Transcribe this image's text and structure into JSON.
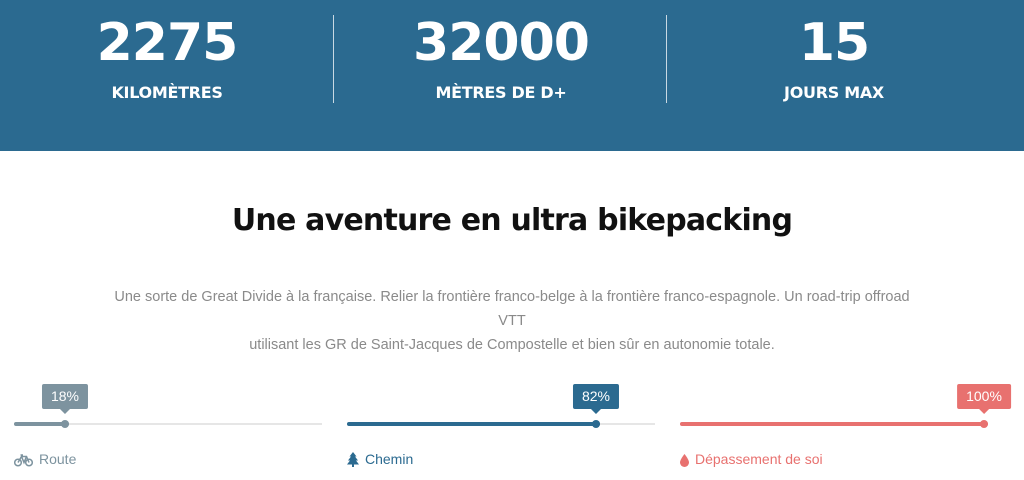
{
  "stats": [
    {
      "value": "2275",
      "label": "KILOMÈTRES"
    },
    {
      "value": "32000",
      "label": "MÈTRES DE D+"
    },
    {
      "value": "15",
      "label": "JOURS MAX"
    }
  ],
  "section": {
    "title": "Une aventure en ultra bikepacking",
    "intro_line1": "Une sorte de Great Divide à la française. Relier la frontière franco-belge à la frontière franco-espagnole. Un road-trip offroad VTT",
    "intro_line2": "utilisant les GR de Saint-Jacques de Compostelle et bien sûr en autonomie totale."
  },
  "progress": [
    {
      "percent_label": "18%",
      "value": 0.18,
      "label": "Route",
      "icon": "bicycle-icon",
      "color": "#7d939f"
    },
    {
      "percent_label": "82%",
      "value": 0.82,
      "label": "Chemin",
      "icon": "tree-icon",
      "color": "#2b6a90"
    },
    {
      "percent_label": "100%",
      "value": 1.0,
      "label": "Dépassement de soi",
      "icon": "drop-icon",
      "color": "#e8716f"
    }
  ],
  "colors": {
    "banner": "#2b6a90",
    "text_muted": "#8a8a8a"
  }
}
